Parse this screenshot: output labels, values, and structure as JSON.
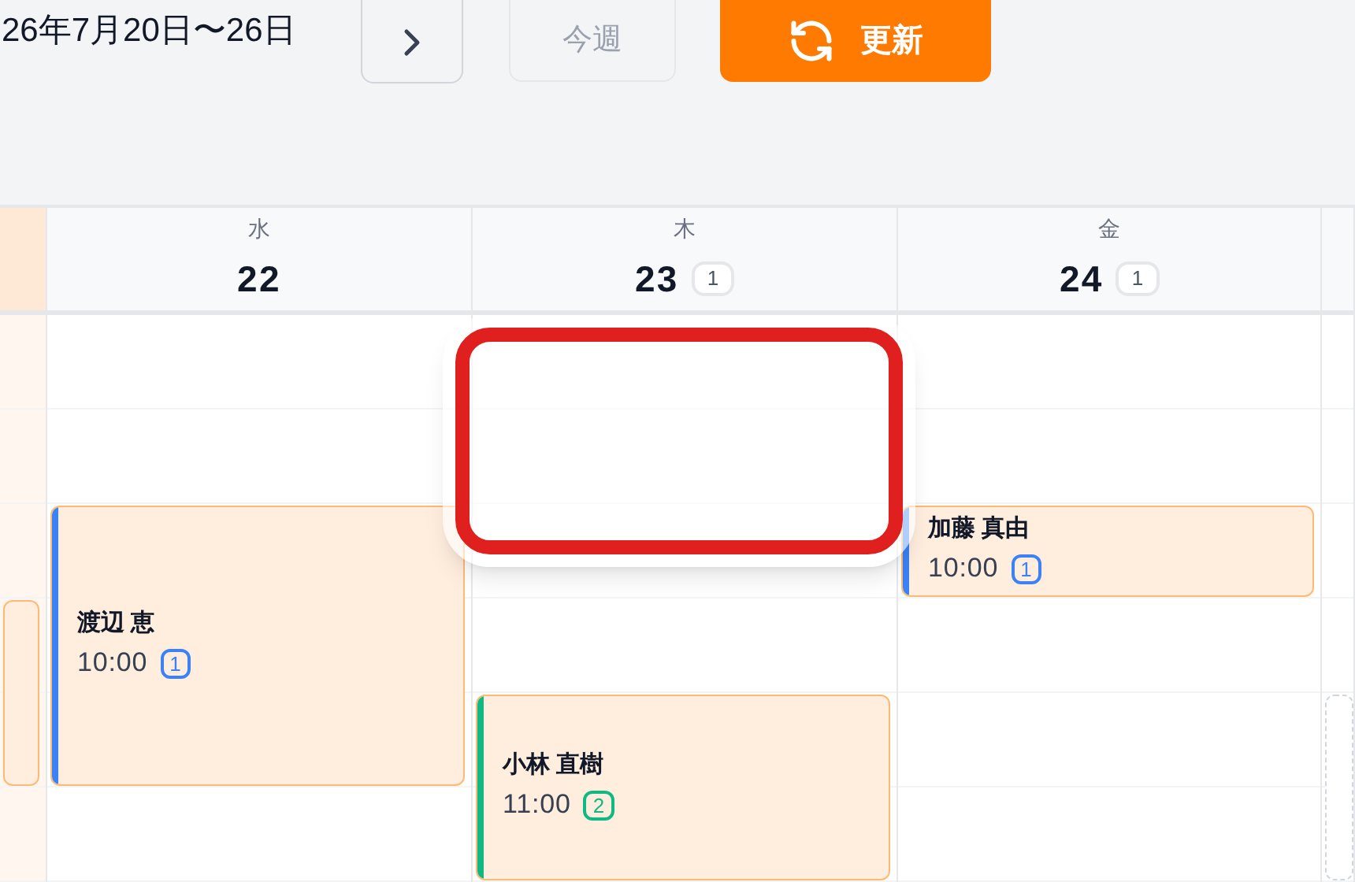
{
  "toolbar": {
    "date_range": "26年7月20日〜26日",
    "this_week": {
      "label": "今週",
      "disabled": true
    },
    "refresh": {
      "label": "更新"
    }
  },
  "days": [
    {
      "today": true,
      "events": [
        {
          "kind": "clipped"
        }
      ]
    },
    {
      "today": false,
      "weekday": "水",
      "date": "22",
      "events": [
        {
          "kind": "extended",
          "name": "渡辺 恵",
          "time": "10:00",
          "count": "1",
          "color": "#3b82f6"
        }
      ]
    },
    {
      "today": false,
      "weekday": "木",
      "date": "23",
      "count": "1",
      "events": [
        {
          "kind": "standard",
          "name": "小林 直樹",
          "time": "11:00",
          "count": "2",
          "color": "#10b981"
        }
      ]
    },
    {
      "today": false,
      "weekday": "金",
      "date": "24",
      "count": "1",
      "events": [
        {
          "kind": "brief",
          "name": "加藤 真由",
          "time": "10:00",
          "count": "1",
          "color": "#3b82f6"
        }
      ]
    },
    {
      "today": false,
      "events": [
        {
          "kind": "tentative"
        }
      ]
    }
  ]
}
